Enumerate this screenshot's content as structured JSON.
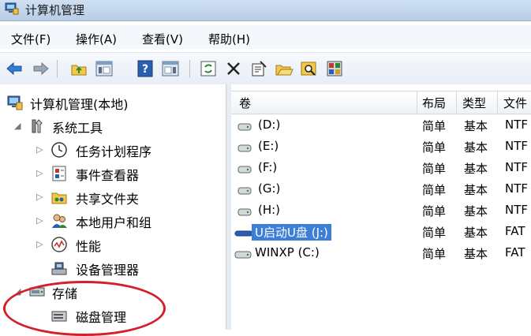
{
  "window": {
    "title": "计算机管理"
  },
  "menu": [
    {
      "label": "文件(F)",
      "name": "menu-file"
    },
    {
      "label": "操作(A)",
      "name": "menu-action"
    },
    {
      "label": "查看(V)",
      "name": "menu-view"
    },
    {
      "label": "帮助(H)",
      "name": "menu-help"
    }
  ],
  "tree": {
    "root": "计算机管理(本地)",
    "system_tools": "系统工具",
    "task_scheduler": "任务计划程序",
    "event_viewer": "事件查看器",
    "shared_folders": "共享文件夹",
    "local_users": "本地用户和组",
    "performance": "性能",
    "device_manager": "设备管理器",
    "storage": "存储",
    "disk_management": "磁盘管理"
  },
  "columns": [
    "卷",
    "布局",
    "类型",
    "文件"
  ],
  "volumes": [
    {
      "name": "(D:)",
      "layout": "简单",
      "type": "基本",
      "fs": "NTF"
    },
    {
      "name": "(E:)",
      "layout": "简单",
      "type": "基本",
      "fs": "NTF"
    },
    {
      "name": "(F:)",
      "layout": "简单",
      "type": "基本",
      "fs": "NTF"
    },
    {
      "name": "(G:)",
      "layout": "简单",
      "type": "基本",
      "fs": "NTF"
    },
    {
      "name": "(H:)",
      "layout": "简单",
      "type": "基本",
      "fs": "NTF"
    },
    {
      "name": "U启动U盘 (J:)",
      "layout": "简单",
      "type": "基本",
      "fs": "FAT"
    },
    {
      "name": "WINXP (C:)",
      "layout": "简单",
      "type": "基本",
      "fs": "FAT"
    }
  ],
  "colors": {
    "selection": "#3d7fd6",
    "annotation_ring": "#d4202a"
  }
}
